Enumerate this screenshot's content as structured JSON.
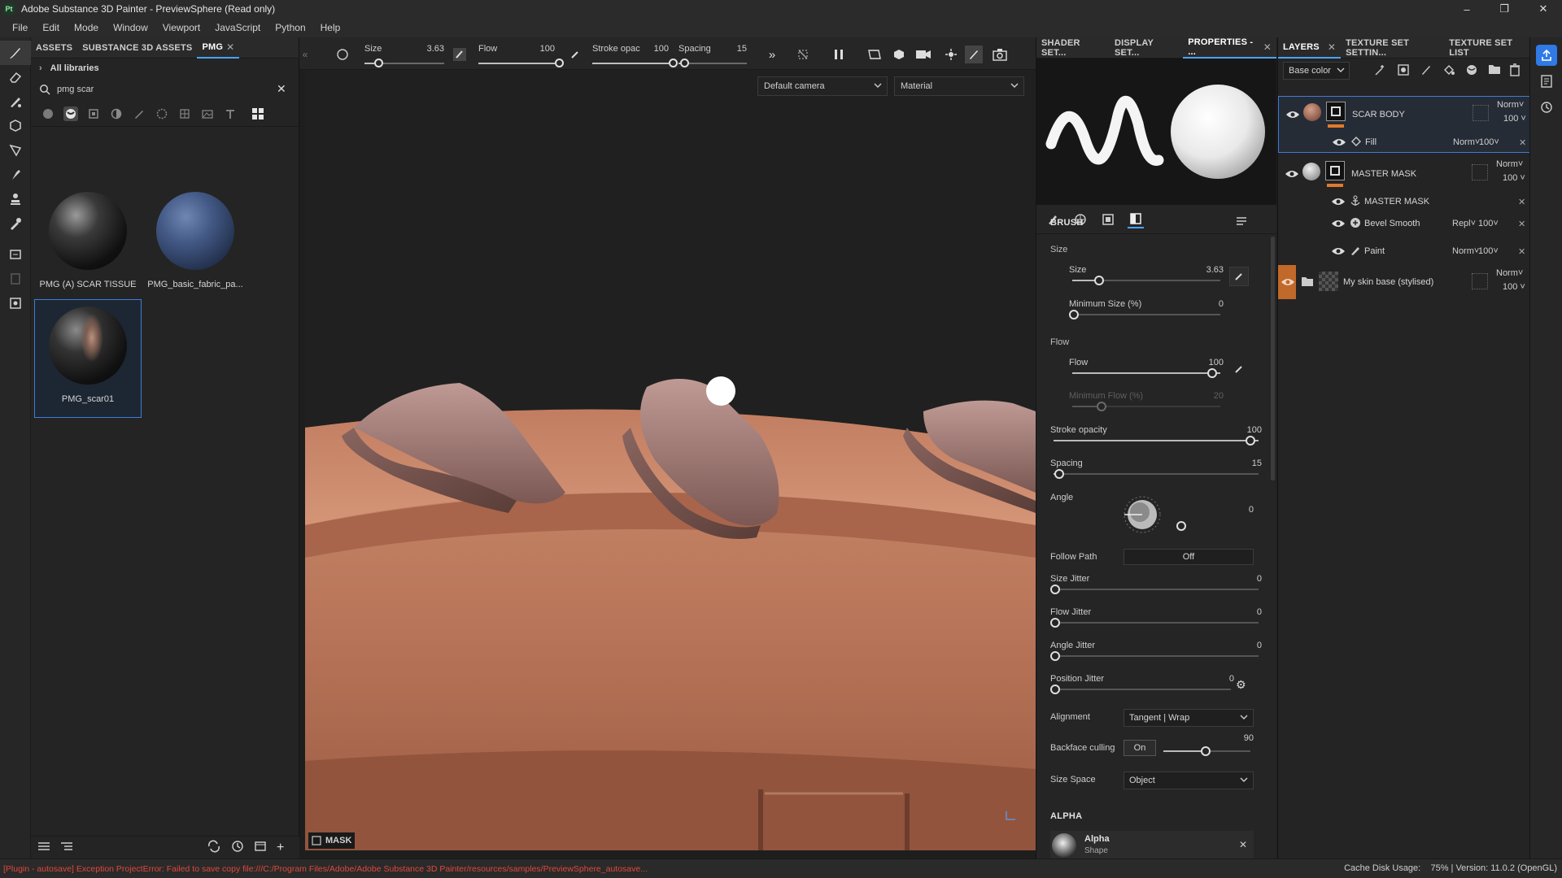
{
  "window": {
    "title": "Adobe Substance 3D Painter - PreviewSphere (Read only)",
    "app_badge": "Pt"
  },
  "menu": [
    "File",
    "Edit",
    "Mode",
    "Window",
    "Viewport",
    "JavaScript",
    "Python",
    "Help"
  ],
  "assets": {
    "tabs": [
      "ASSETS",
      "SUBSTANCE 3D ASSETS",
      "PMG"
    ],
    "libraries": "All libraries",
    "search_value": "pmg scar",
    "items": [
      {
        "label": "PMG (A) SCAR TISSUE"
      },
      {
        "label": "PMG_basic_fabric_pa..."
      },
      {
        "label": "PMG_scar01",
        "selected": true
      }
    ]
  },
  "toolbar": {
    "size_label": "Size",
    "size_value": "3.63",
    "size_fraction": 0.12,
    "flow_label": "Flow",
    "flow_value": "100",
    "flow_fraction": 1.0,
    "stroke_label": "Stroke opac",
    "stroke_value": "100",
    "stroke_fraction": 1.0,
    "spacing_label": "Spacing",
    "spacing_value": "15",
    "spacing_fraction": 0.02
  },
  "viewport": {
    "camera": "Default camera",
    "mode": "Material",
    "mask_label": "MASK"
  },
  "properties": {
    "tabs": [
      "SHADER SET...",
      "DISPLAY SET...",
      "PROPERTIES - ..."
    ],
    "brush_title": "BRUSH",
    "size_group": "Size",
    "size_label": "Size",
    "size_value": "3.63",
    "size_fraction": 0.18,
    "min_size_label": "Minimum Size (%)",
    "min_size_value": "0",
    "min_size_fraction": 0.0,
    "flow_group": "Flow",
    "flow_label": "Flow",
    "flow_value": "100",
    "flow_fraction": 1.0,
    "min_flow_label": "Minimum Flow (%)",
    "min_flow_value": "20",
    "min_flow_fraction": 0.2,
    "stroke_label": "Stroke opacity",
    "stroke_value": "100",
    "stroke_fraction": 1.0,
    "spacing_label": "Spacing",
    "spacing_value": "15",
    "spacing_fraction": 0.02,
    "angle_label": "Angle",
    "angle_value": "0",
    "follow_path_label": "Follow Path",
    "follow_path_value": "Off",
    "size_jitter_label": "Size Jitter",
    "size_jitter_value": "0",
    "flow_jitter_label": "Flow Jitter",
    "flow_jitter_value": "0",
    "angle_jitter_label": "Angle Jitter",
    "angle_jitter_value": "0",
    "pos_jitter_label": "Position Jitter",
    "pos_jitter_value": "0",
    "alignment_label": "Alignment",
    "alignment_value": "Tangent | Wrap",
    "backface_label": "Backface culling",
    "backface_toggle": "On",
    "backface_value": "90",
    "backface_fraction": 0.5,
    "size_space_label": "Size Space",
    "size_space_value": "Object",
    "alpha_title": "ALPHA",
    "alpha_name": "Alpha",
    "alpha_sub": "Shape"
  },
  "layers": {
    "tabs": [
      "LAYERS",
      "TEXTURE SET SETTIN...",
      "TEXTURE SET LIST"
    ],
    "channel": "Base color",
    "items": [
      {
        "name": "SCAR BODY",
        "blend": "Norm",
        "opacity": "100"
      },
      {
        "name": "Fill",
        "blend": "Norm",
        "opacity": "100"
      },
      {
        "name": "MASTER MASK",
        "blend": "Norm",
        "opacity": "100"
      },
      {
        "name": "MASTER MASK"
      },
      {
        "name": "Bevel Smooth",
        "blend": "Repl",
        "opacity": "100"
      },
      {
        "name": "Paint",
        "blend": "Norm",
        "opacity": "100"
      },
      {
        "name": "My skin base (stylised)",
        "blend": "Norm",
        "opacity": "100"
      }
    ]
  },
  "status": {
    "error": "[Plugin - autosave] Exception ProjectError: Failed to save copy file:///C:/Program Files/Adobe/Adobe Substance 3D Painter/resources/samples/PreviewSphere_autosave...",
    "cache": "Cache Disk Usage:",
    "info": "75% | Version: 11.0.2 (OpenGL)"
  },
  "colors": {
    "accent": "#4aa3ff",
    "skin": "#c58468",
    "error": "#e0483a",
    "orange": "#e07a2c"
  }
}
